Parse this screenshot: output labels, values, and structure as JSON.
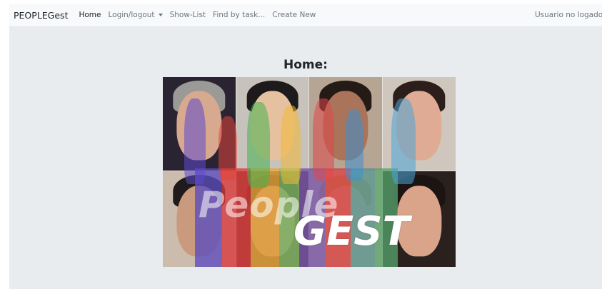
{
  "navbar": {
    "brand": "PEOPLEGest",
    "links": [
      {
        "label": "Home",
        "active": true
      },
      {
        "label": "Login/logout",
        "dropdown": true
      },
      {
        "label": "Show-List"
      },
      {
        "label": "Find by task..."
      },
      {
        "label": "Create New"
      }
    ],
    "user_status": "Usuario no logado :-("
  },
  "main": {
    "title": "Home:",
    "hero_logo": {
      "word1": "People",
      "word2": "GEST"
    }
  },
  "colors": {
    "navbar_bg": "#f8f9fa",
    "page_bg": "#e9ecef",
    "text_dark": "#212529",
    "text_muted": "#6c757d"
  }
}
